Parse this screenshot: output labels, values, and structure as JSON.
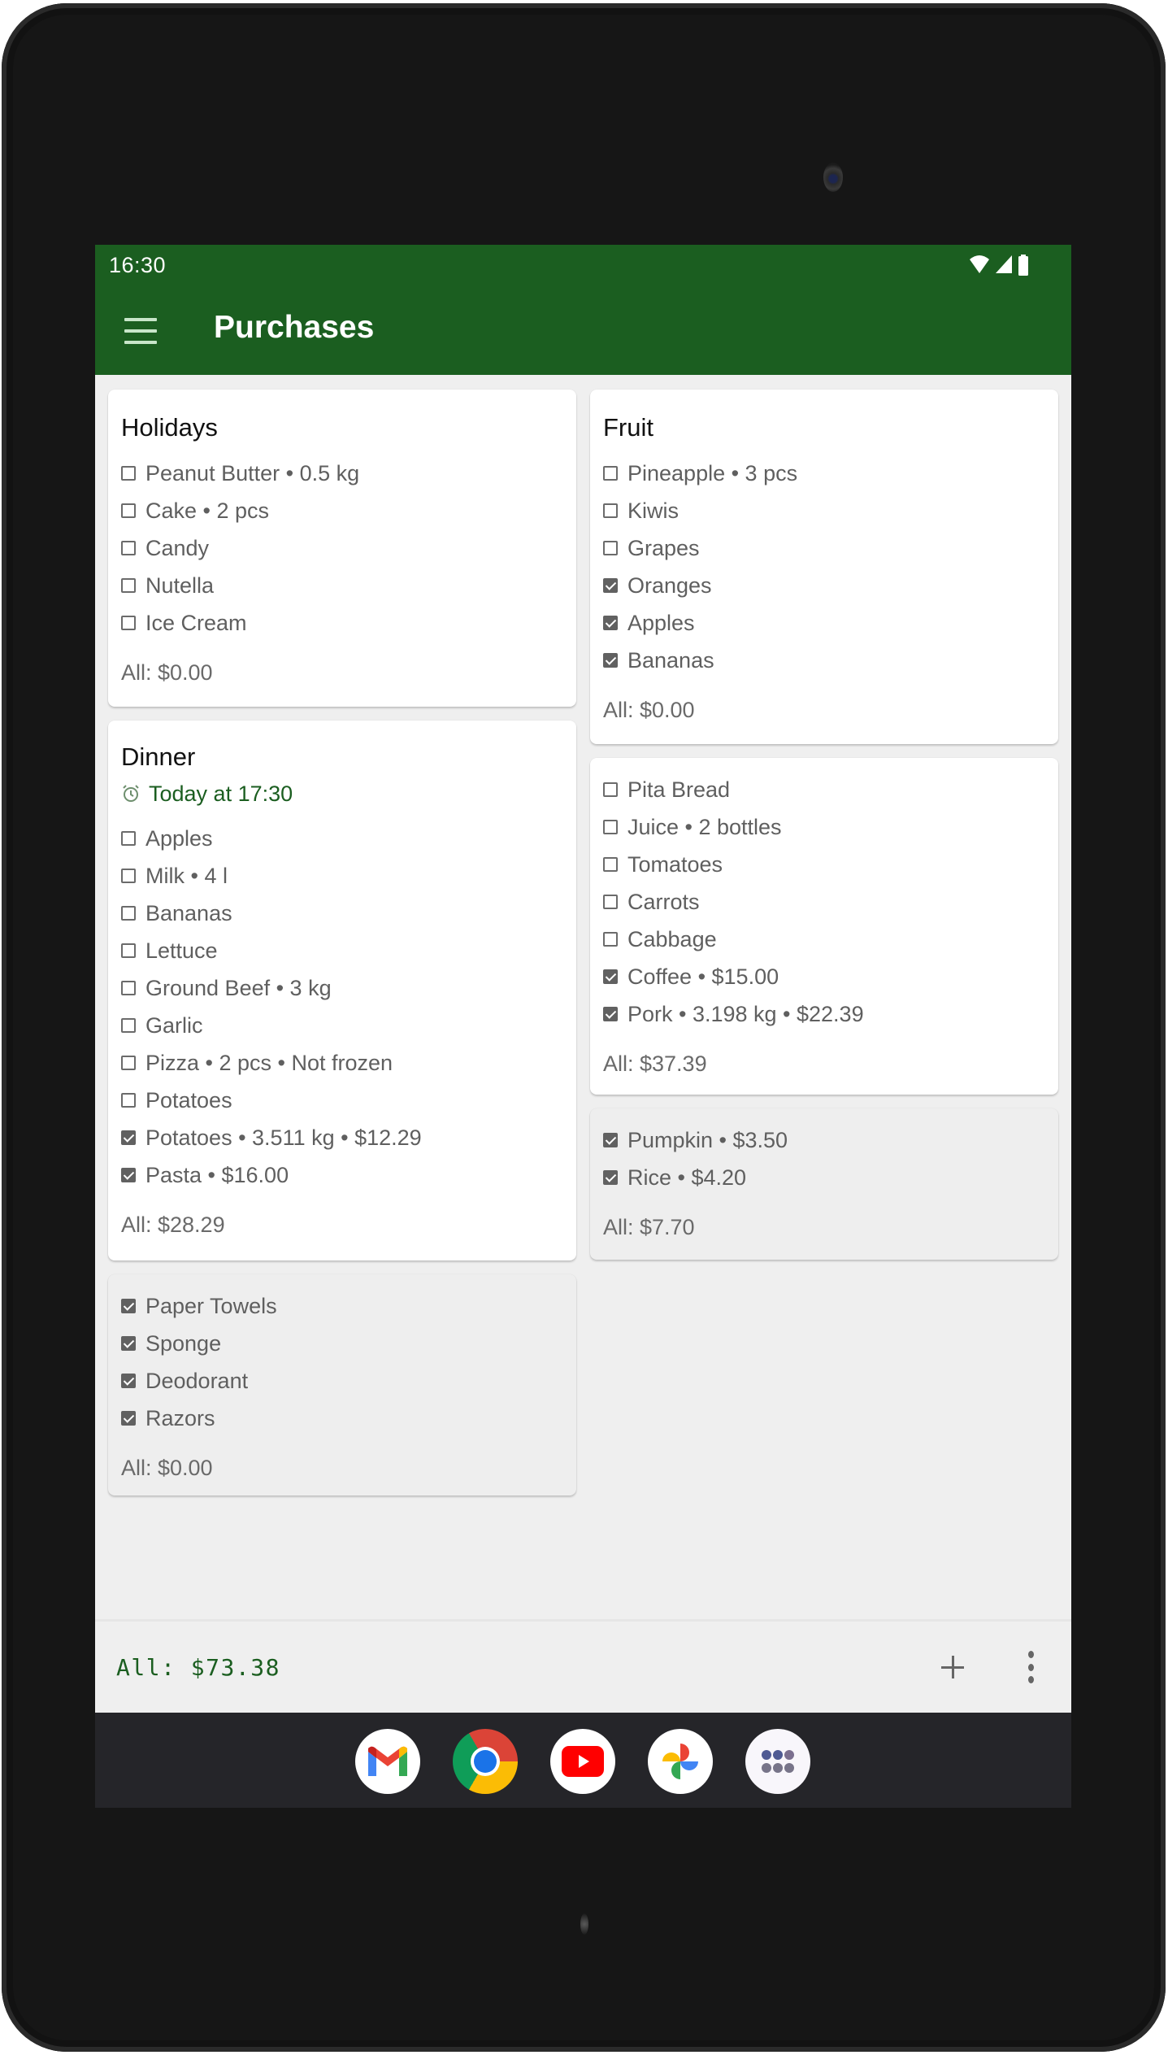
{
  "status_bar": {
    "time": "16:30",
    "icons": [
      "wifi-icon",
      "cell-signal-icon",
      "battery-icon"
    ]
  },
  "app_bar": {
    "title": "Purchases",
    "menu_icon": "hamburger-menu-icon"
  },
  "colors": {
    "primary": "#1b5e20",
    "accent_text": "#1b5e20",
    "card_bg": "#ffffff",
    "completed_card_bg": "#eeeeee",
    "screen_bg": "#efefef"
  },
  "lists": [
    {
      "title": "Holidays",
      "reminder": null,
      "completed": false,
      "items": [
        {
          "text": "Peanut Butter • 0.5 kg",
          "checked": false
        },
        {
          "text": "Cake • 2 pcs",
          "checked": false
        },
        {
          "text": "Candy",
          "checked": false
        },
        {
          "text": "Nutella",
          "checked": false
        },
        {
          "text": "Ice Cream",
          "checked": false
        }
      ],
      "total": "All: $0.00"
    },
    {
      "title": "Fruit",
      "reminder": null,
      "completed": false,
      "items": [
        {
          "text": "Pineapple • 3 pcs",
          "checked": false
        },
        {
          "text": "Kiwis",
          "checked": false
        },
        {
          "text": "Grapes",
          "checked": false
        },
        {
          "text": "Oranges",
          "checked": true
        },
        {
          "text": "Apples",
          "checked": true
        },
        {
          "text": "Bananas",
          "checked": true
        }
      ],
      "total": "All: $0.00"
    },
    {
      "title": "Dinner",
      "reminder": "Today at 17:30",
      "completed": false,
      "items": [
        {
          "text": "Apples",
          "checked": false
        },
        {
          "text": "Milk • 4 l",
          "checked": false
        },
        {
          "text": "Bananas",
          "checked": false
        },
        {
          "text": "Lettuce",
          "checked": false
        },
        {
          "text": "Ground Beef • 3 kg",
          "checked": false
        },
        {
          "text": "Garlic",
          "checked": false
        },
        {
          "text": "Pizza • 2 pcs • Not frozen",
          "checked": false
        },
        {
          "text": "Potatoes",
          "checked": false
        },
        {
          "text": "Potatoes • 3.511 kg • $12.29",
          "checked": true
        },
        {
          "text": "Pasta • $16.00",
          "checked": true
        }
      ],
      "total": "All: $28.29"
    },
    {
      "title": null,
      "reminder": null,
      "completed": false,
      "items": [
        {
          "text": "Pita Bread",
          "checked": false
        },
        {
          "text": "Juice • 2 bottles",
          "checked": false
        },
        {
          "text": "Tomatoes",
          "checked": false
        },
        {
          "text": "Carrots",
          "checked": false
        },
        {
          "text": "Cabbage",
          "checked": false
        },
        {
          "text": "Coffee • $15.00",
          "checked": true
        },
        {
          "text": "Pork • 3.198 kg • $22.39",
          "checked": true
        }
      ],
      "total": "All: $37.39"
    },
    {
      "title": null,
      "reminder": null,
      "completed": true,
      "items": [
        {
          "text": "Pumpkin • $3.50",
          "checked": true
        },
        {
          "text": "Rice • $4.20",
          "checked": true
        }
      ],
      "total": "All: $7.70"
    },
    {
      "title": null,
      "reminder": null,
      "completed": true,
      "items": [
        {
          "text": "Paper Towels",
          "checked": true
        },
        {
          "text": "Sponge",
          "checked": true
        },
        {
          "text": "Deodorant",
          "checked": true
        },
        {
          "text": "Razors",
          "checked": true
        }
      ],
      "total": "All: $0.00"
    }
  ],
  "bottom_bar": {
    "grand_total": "All: $73.38",
    "add_icon": "plus-icon",
    "more_icon": "more-vert-icon"
  },
  "dock": {
    "apps": [
      "Gmail",
      "Chrome",
      "YouTube",
      "Photos",
      "App Drawer"
    ]
  }
}
